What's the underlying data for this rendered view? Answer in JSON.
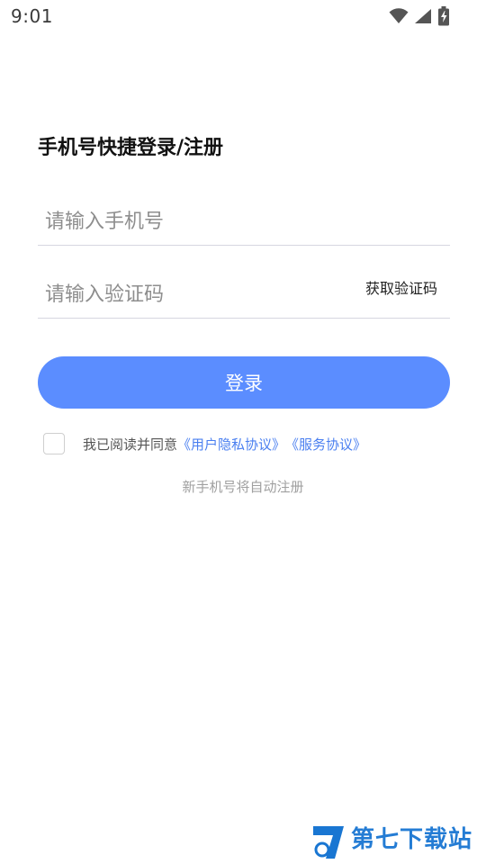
{
  "status_bar": {
    "time": "9:01",
    "icons": [
      "wifi-icon",
      "signal-icon",
      "battery-charging-icon"
    ]
  },
  "login": {
    "title": "手机号快捷登录/注册",
    "phone_placeholder": "请输入手机号",
    "code_placeholder": "请输入验证码",
    "get_code_label": "获取验证码",
    "login_button_label": "登录",
    "agreement_text": "我已阅读并同意",
    "privacy_link": "《用户隐私协议》",
    "service_link": "《服务协议》",
    "auto_register_hint": "新手机号将自动注册"
  },
  "watermark": {
    "brand": "第七下载站"
  },
  "colors": {
    "accent": "#5b8dff",
    "link": "#4a7ff0",
    "hint": "#a0a0a0"
  }
}
